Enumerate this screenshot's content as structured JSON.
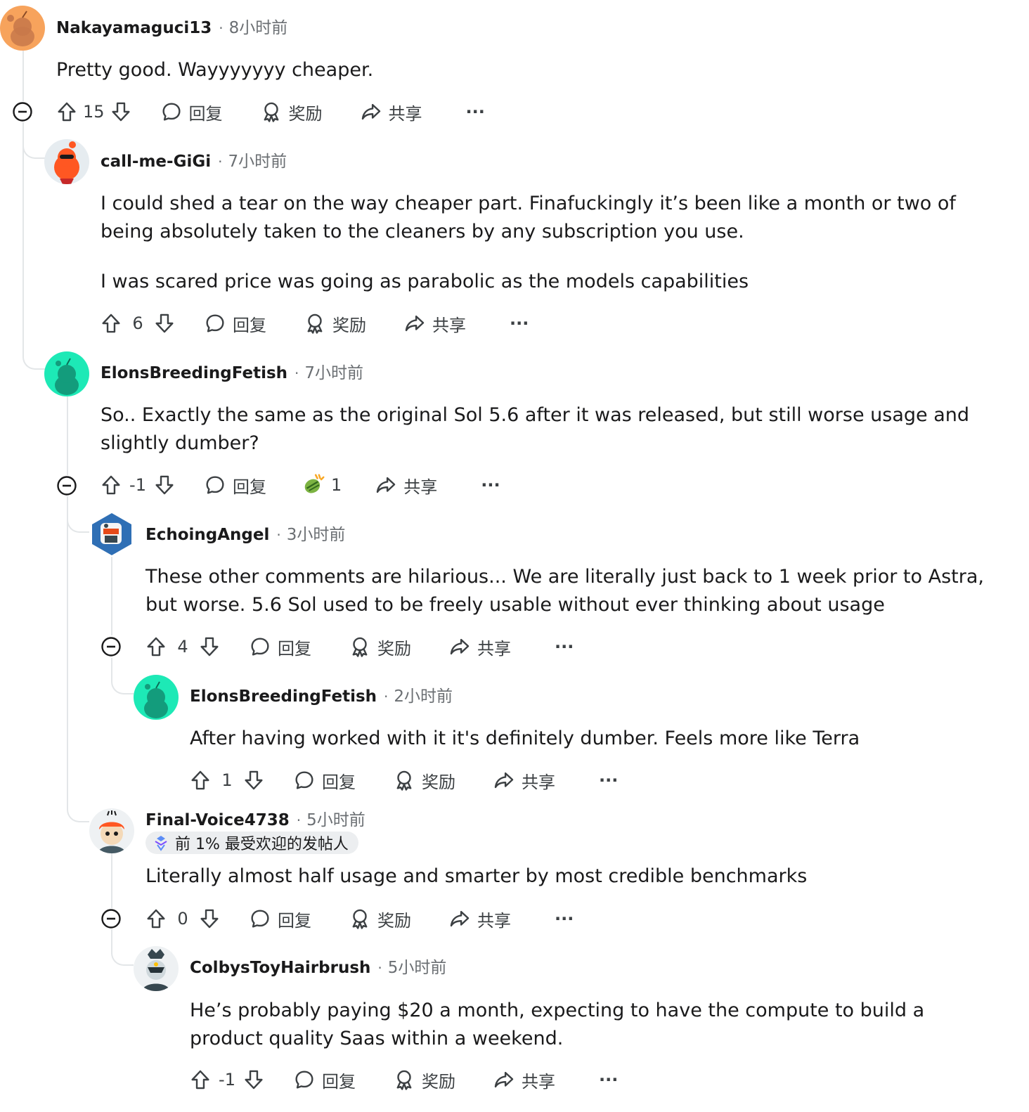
{
  "labels": {
    "reply": "回复",
    "award": "奖励",
    "share": "共享",
    "more": "···",
    "dot": "·"
  },
  "comments": [
    {
      "username": "Nakayamaguci13",
      "time": "8小时前",
      "body": [
        "Pretty good. Wayyyyyyy cheaper."
      ],
      "score": "15"
    },
    {
      "username": "call-me-GiGi",
      "time": "7小时前",
      "body": [
        "I could shed a tear on the way cheaper part. Finafuckingly it’s been like a month or two of being absolutely taken to the cleaners by any subscription you use.",
        "I was scared price was going as parabolic as the models capabilities"
      ],
      "score": "6"
    },
    {
      "username": "ElonsBreedingFetish",
      "time": "7小时前",
      "body": [
        "So.. Exactly the same as the original Sol 5.6 after it was released, but still worse usage and slightly dumber?"
      ],
      "score": "-1",
      "award_count": "1"
    },
    {
      "username": "EchoingAngel",
      "time": "3小时前",
      "body": [
        "These other comments are hilarious... We are literally just back to 1 week prior to Astra, but worse. 5.6 Sol used to be freely usable without ever thinking about usage"
      ],
      "score": "4"
    },
    {
      "username": "ElonsBreedingFetish",
      "time": "2小时前",
      "body": [
        "After having worked with it it's definitely dumber. Feels more like Terra"
      ],
      "score": "1"
    },
    {
      "username": "Final-Voice4738",
      "time": "5小时前",
      "badge": "前 1% 最受欢迎的发帖人",
      "body": [
        "Literally almost half usage and smarter by most credible benchmarks"
      ],
      "score": "0"
    },
    {
      "username": "ColbysToyHairbrush",
      "time": "5小时前",
      "body": [
        "He’s probably paying $20 a month, expecting to have the compute to build a product quality Saas within a weekend."
      ],
      "score": "-1"
    }
  ],
  "colors": {
    "thread_line": "#e3e6e8",
    "meta_gray": "#6b6f73",
    "text": "#1a1a1b",
    "teal": "#1de9b6",
    "orange": "#f7a35c"
  }
}
